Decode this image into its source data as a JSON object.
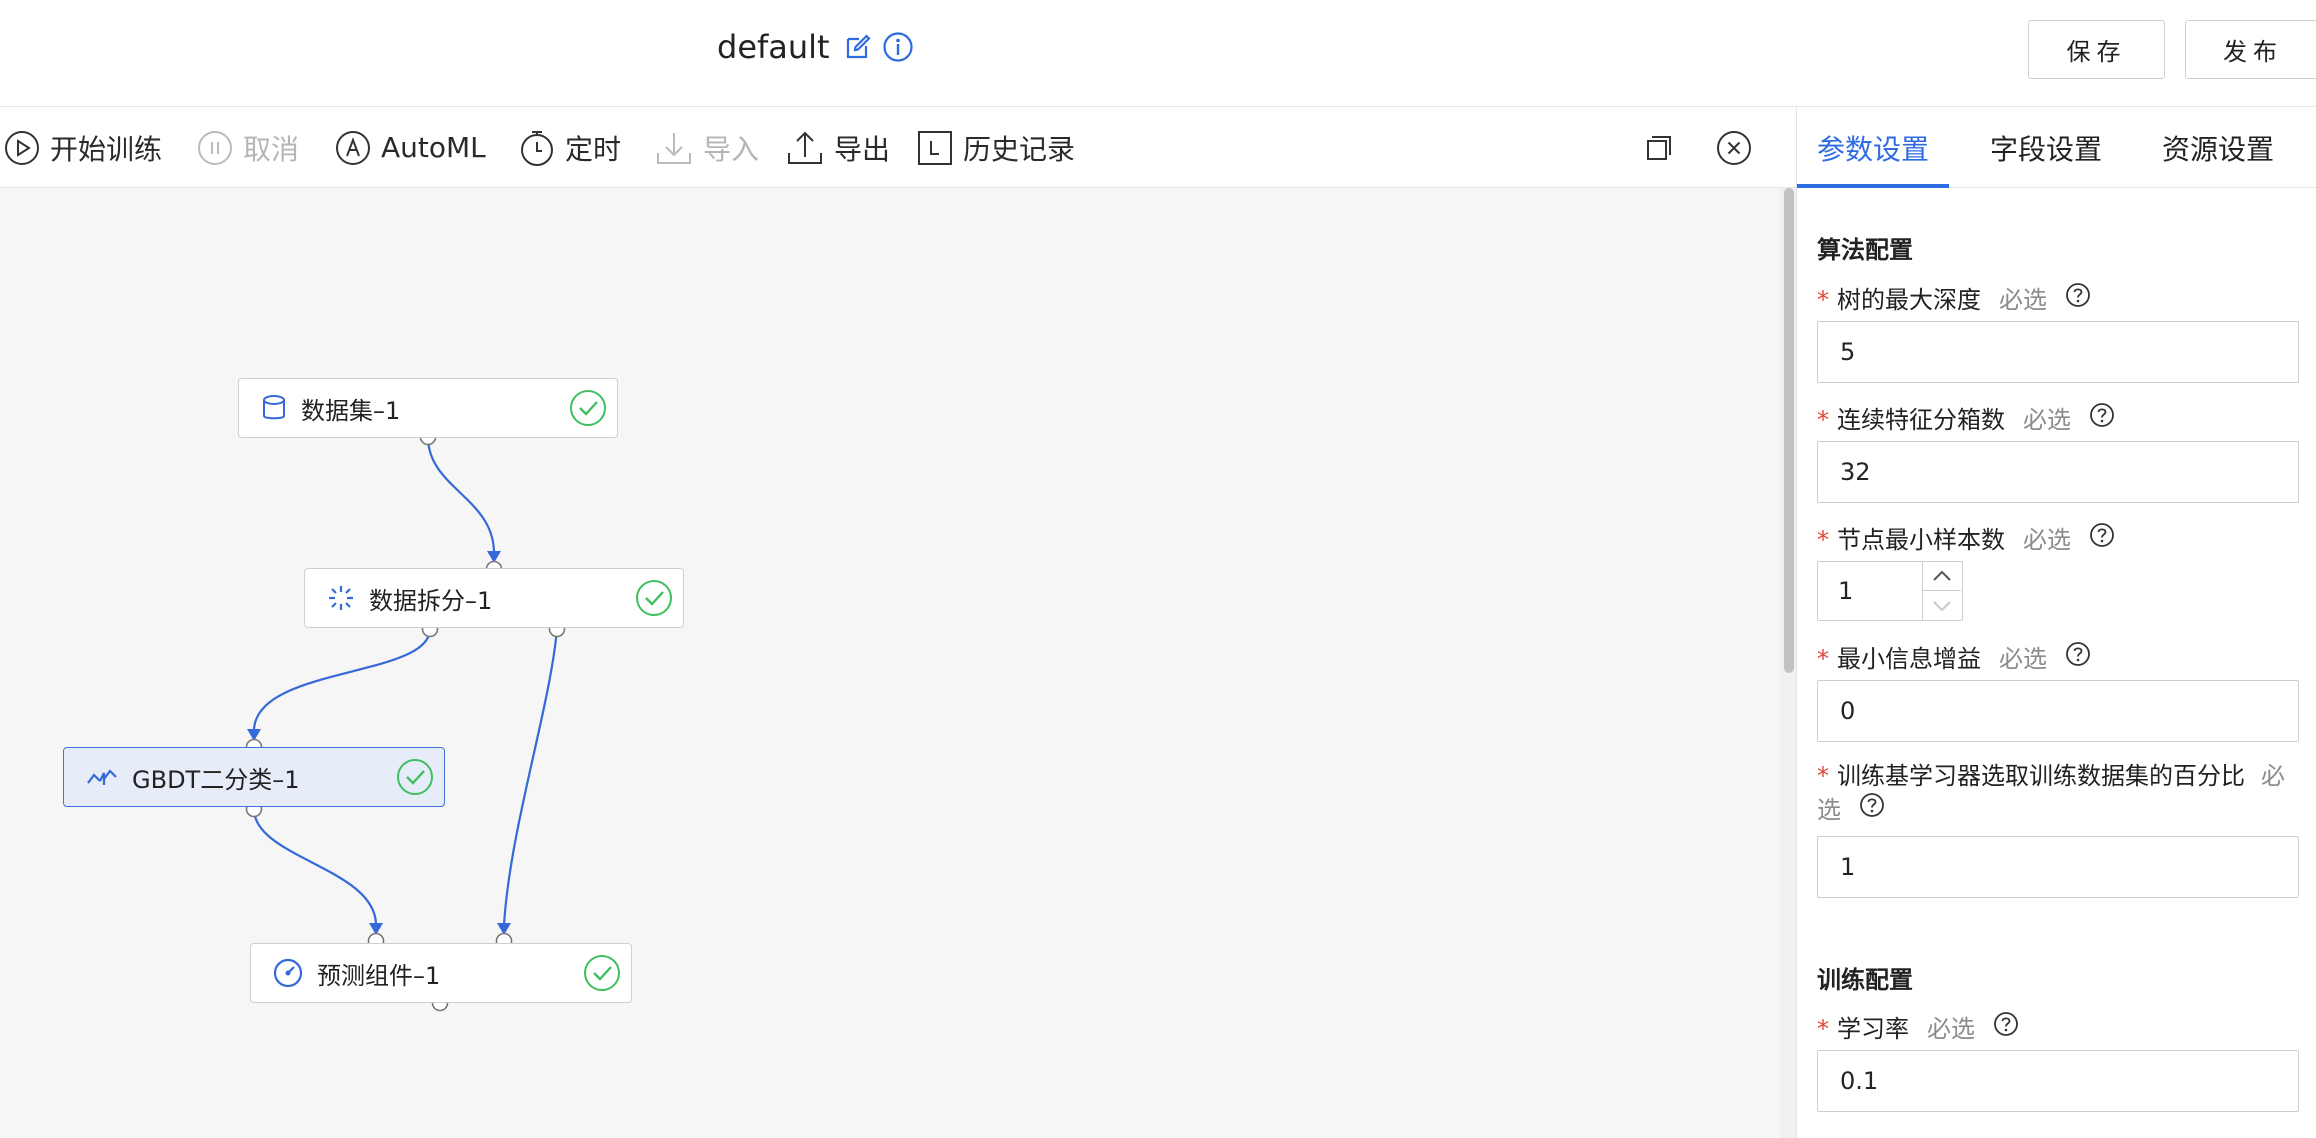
{
  "header": {
    "title": "default",
    "save_label": "保存",
    "publish_label": "发布"
  },
  "toolbar": {
    "start_training": "开始训练",
    "cancel": "取消",
    "automl": "AutoML",
    "schedule": "定时",
    "import": "导入",
    "export": "导出",
    "history": "历史记录"
  },
  "nodes": {
    "dataset": "数据集–1",
    "split": "数据拆分–1",
    "gbdt": "GBDT二分类–1",
    "predict": "预测组件–1"
  },
  "panel": {
    "tabs": [
      "参数设置",
      "字段设置",
      "资源设置"
    ],
    "active_tab": 0,
    "algo_section": "算法配置",
    "train_section": "训练配置",
    "required_mark": "*",
    "must_text": "必选",
    "fields": {
      "max_depth": {
        "label": "树的最大深度",
        "value": "5"
      },
      "bins": {
        "label": "连续特征分箱数",
        "value": "32"
      },
      "min_samples": {
        "label": "节点最小样本数",
        "value": "1"
      },
      "min_gain": {
        "label": "最小信息增益",
        "value": "0"
      },
      "subsample": {
        "label": "训练基学习器选取训练数据集的百分比",
        "must_a": "必",
        "must_b": "选",
        "value": "1"
      },
      "learning_rate": {
        "label": "学习率",
        "value": "0.1"
      }
    }
  },
  "colors": {
    "accent": "#2f6be0",
    "success": "#3fbf5f",
    "required": "#e0443b",
    "edge": "#3568d8"
  }
}
